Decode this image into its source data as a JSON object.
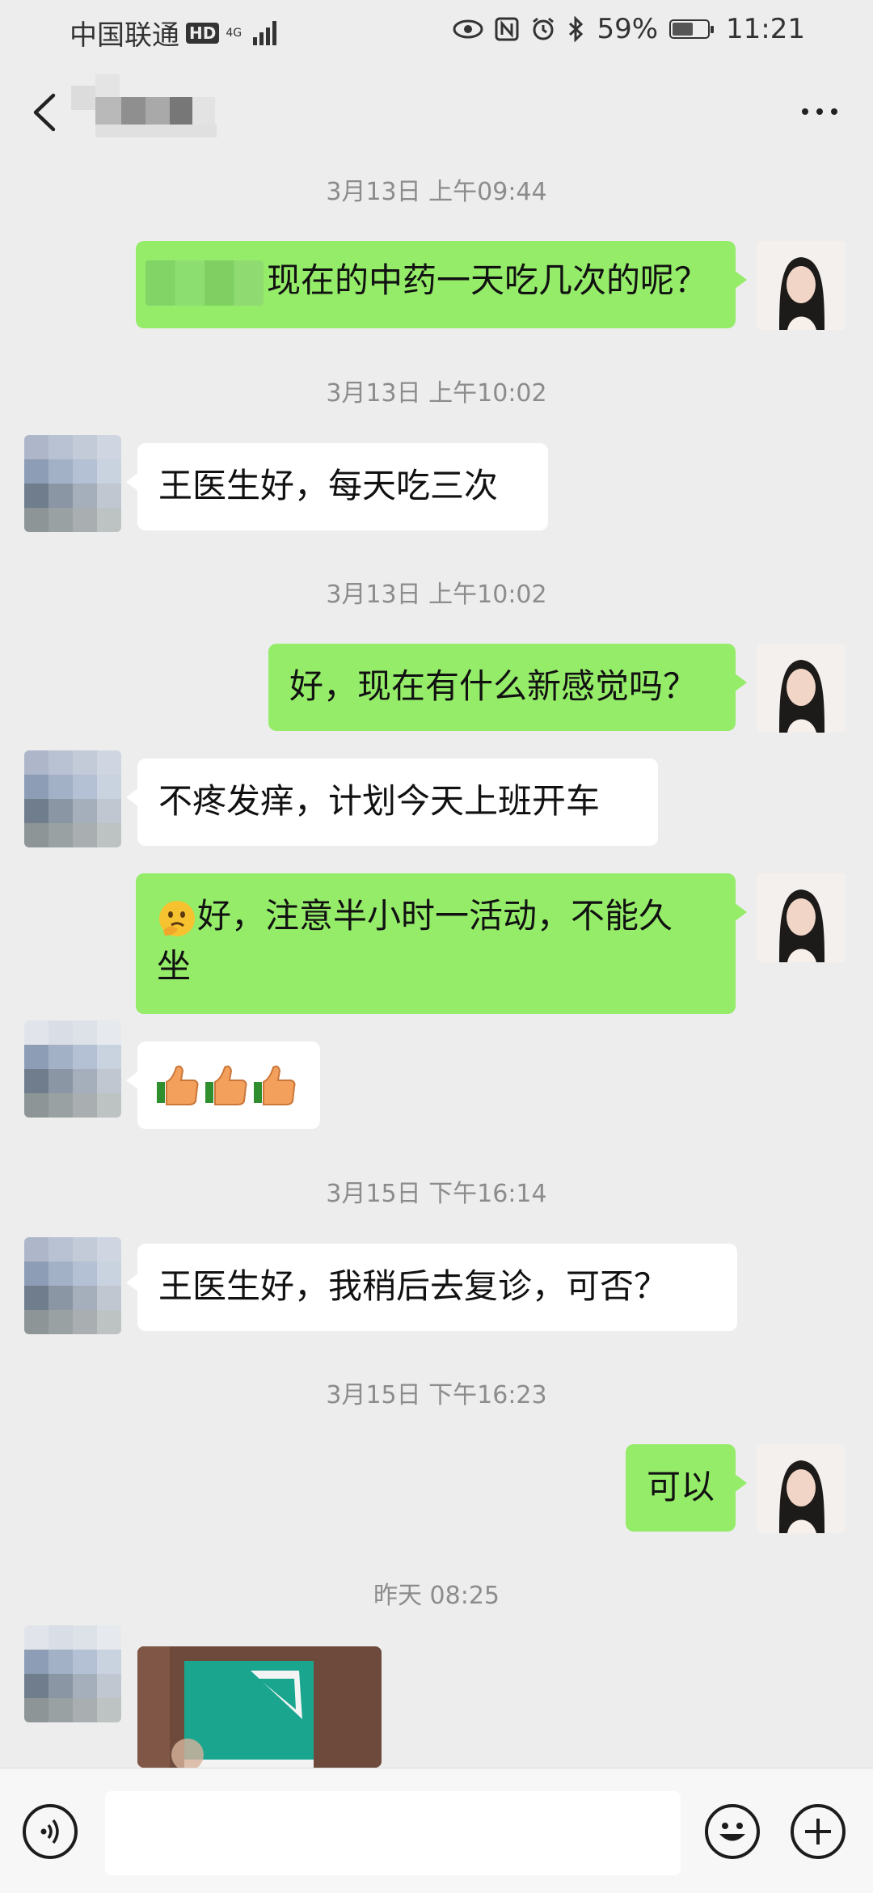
{
  "status_bar": {
    "carrier": "中国联通",
    "hd": "HD",
    "network": "4G",
    "battery": "59%",
    "battery_level": 0.59,
    "time": "11:21"
  },
  "nav": {
    "back_icon": "chevron-left-icon",
    "more_icon": "more-dots-icon"
  },
  "messages": [
    {
      "type": "time",
      "text": "3月13日 上午09:44"
    },
    {
      "type": "sent",
      "text": "现在的中药一天吃几次的呢？"
    },
    {
      "type": "time",
      "text": "3月13日 上午10:02"
    },
    {
      "type": "received",
      "text": "王医生好，每天吃三次"
    },
    {
      "type": "time",
      "text": "3月13日 上午10:02"
    },
    {
      "type": "sent",
      "text": "好，现在有什么新感觉吗？"
    },
    {
      "type": "received",
      "text": "不疼发痒，计划今天上班开车"
    },
    {
      "type": "sent",
      "emoji": "thinking-face-emoji",
      "text_line1": "好，注意半小时一活动，不能久",
      "text_line2": "坐"
    },
    {
      "type": "received",
      "emoji": "thumbs-up-emoji x3"
    },
    {
      "type": "time",
      "text": "3月15日 下午16:14"
    },
    {
      "type": "received",
      "text": "王医生好，我稍后去复诊，可否？"
    },
    {
      "type": "time",
      "text": "3月15日 下午16:23"
    },
    {
      "type": "sent",
      "text": "可以"
    },
    {
      "type": "time",
      "text": "昨天 08:25"
    },
    {
      "type": "received",
      "image": "photo-message"
    }
  ],
  "input_bar": {
    "voice_icon": "voice-icon",
    "emoji_icon": "smiley-icon",
    "plus_icon": "plus-icon"
  },
  "colors": {
    "background": "#ededed",
    "sent_bubble": "#95ec69",
    "received_bubble": "#ffffff",
    "timestamp": "#8c8c8c"
  }
}
